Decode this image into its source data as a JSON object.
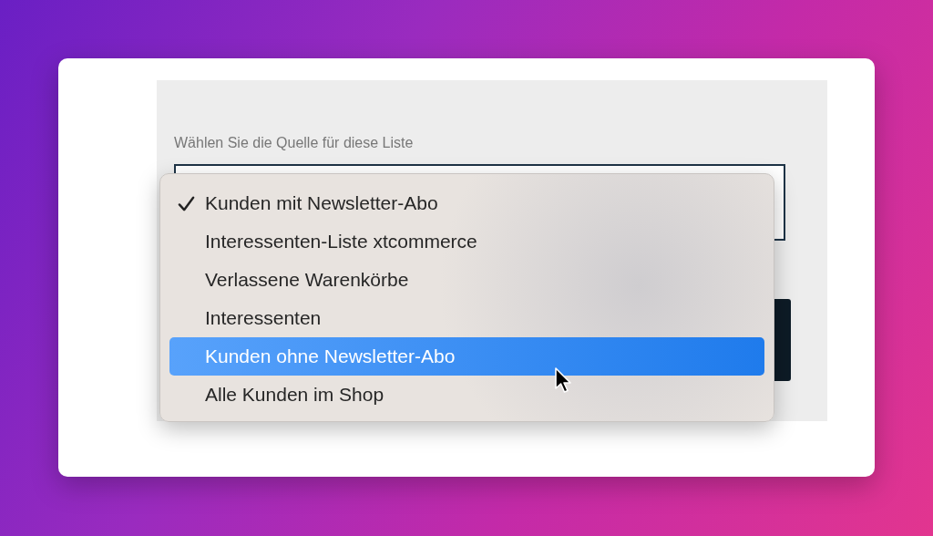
{
  "form": {
    "label": "Wählen Sie die Quelle für diese Liste"
  },
  "dropdown": {
    "options": [
      {
        "label": "Kunden mit Newsletter-Abo",
        "checked": true,
        "highlighted": false
      },
      {
        "label": "Interessenten-Liste xtcommerce",
        "checked": false,
        "highlighted": false
      },
      {
        "label": "Verlassene Warenkörbe",
        "checked": false,
        "highlighted": false
      },
      {
        "label": "Interessenten",
        "checked": false,
        "highlighted": false
      },
      {
        "label": "Kunden ohne Newsletter-Abo",
        "checked": false,
        "highlighted": true
      },
      {
        "label": "Alle Kunden im Shop",
        "checked": false,
        "highlighted": false
      }
    ]
  }
}
